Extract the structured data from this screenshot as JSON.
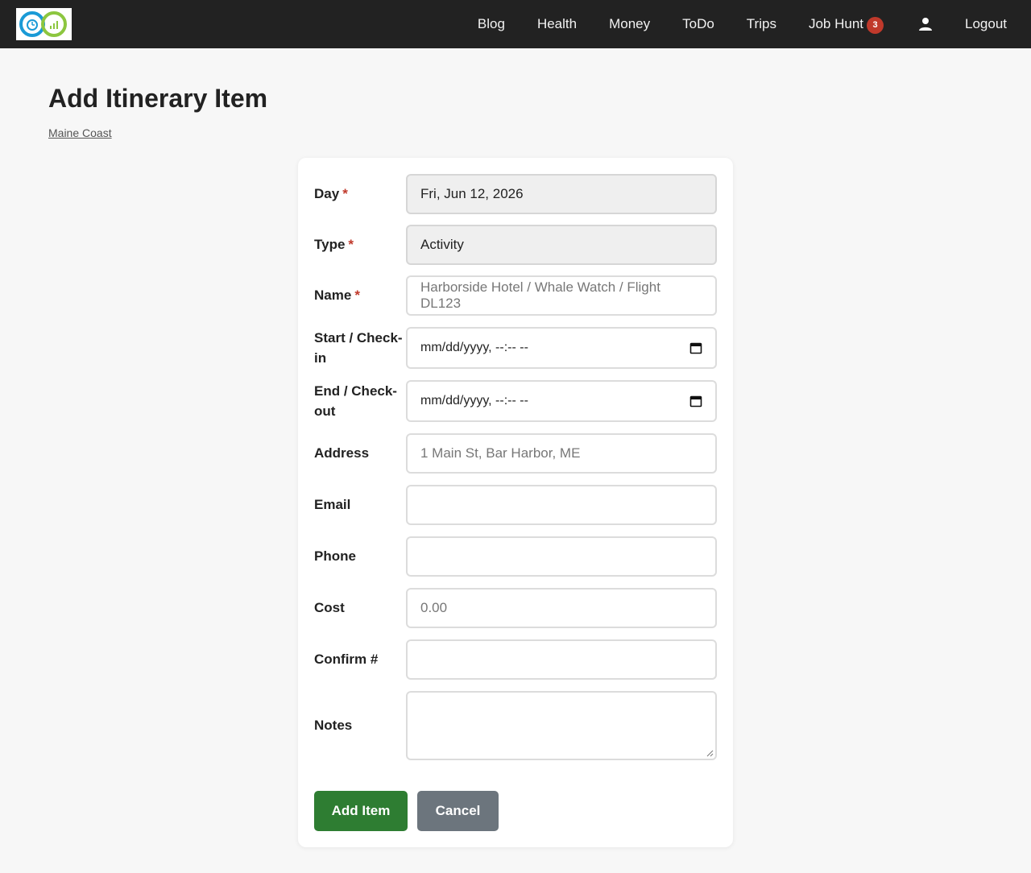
{
  "nav": {
    "links": [
      "Blog",
      "Health",
      "Money",
      "ToDo",
      "Trips",
      "Job Hunt"
    ],
    "job_hunt_badge": "3",
    "logout": "Logout"
  },
  "header": {
    "title": "Add Itinerary Item",
    "breadcrumb": "Maine Coast"
  },
  "form": {
    "day": {
      "label": "Day",
      "value": "Fri, Jun 12, 2026"
    },
    "type": {
      "label": "Type",
      "value": "Activity"
    },
    "name": {
      "label": "Name",
      "placeholder": "Harborside Hotel / Whale Watch / Flight DL123"
    },
    "start": {
      "label": "Start / Check-in",
      "placeholder": "mm/dd/yyyy, --:-- --"
    },
    "end": {
      "label": "End / Check-out",
      "placeholder": "mm/dd/yyyy, --:-- --"
    },
    "address": {
      "label": "Address",
      "placeholder": "1 Main St, Bar Harbor, ME"
    },
    "email": {
      "label": "Email",
      "value": ""
    },
    "phone": {
      "label": "Phone",
      "value": ""
    },
    "cost": {
      "label": "Cost",
      "placeholder": "0.00"
    },
    "confirm": {
      "label": "Confirm #",
      "value": ""
    },
    "notes": {
      "label": "Notes",
      "value": ""
    },
    "required_marker": "*",
    "submit_label": "Add Item",
    "cancel_label": "Cancel"
  },
  "colors": {
    "navbar": "#222222",
    "primary": "#2e7d32",
    "secondary": "#6c757d",
    "required": "#c0392b",
    "badge": "#c0392b"
  },
  "icons": [
    "app-logo",
    "user-icon",
    "calendar-icon"
  ]
}
